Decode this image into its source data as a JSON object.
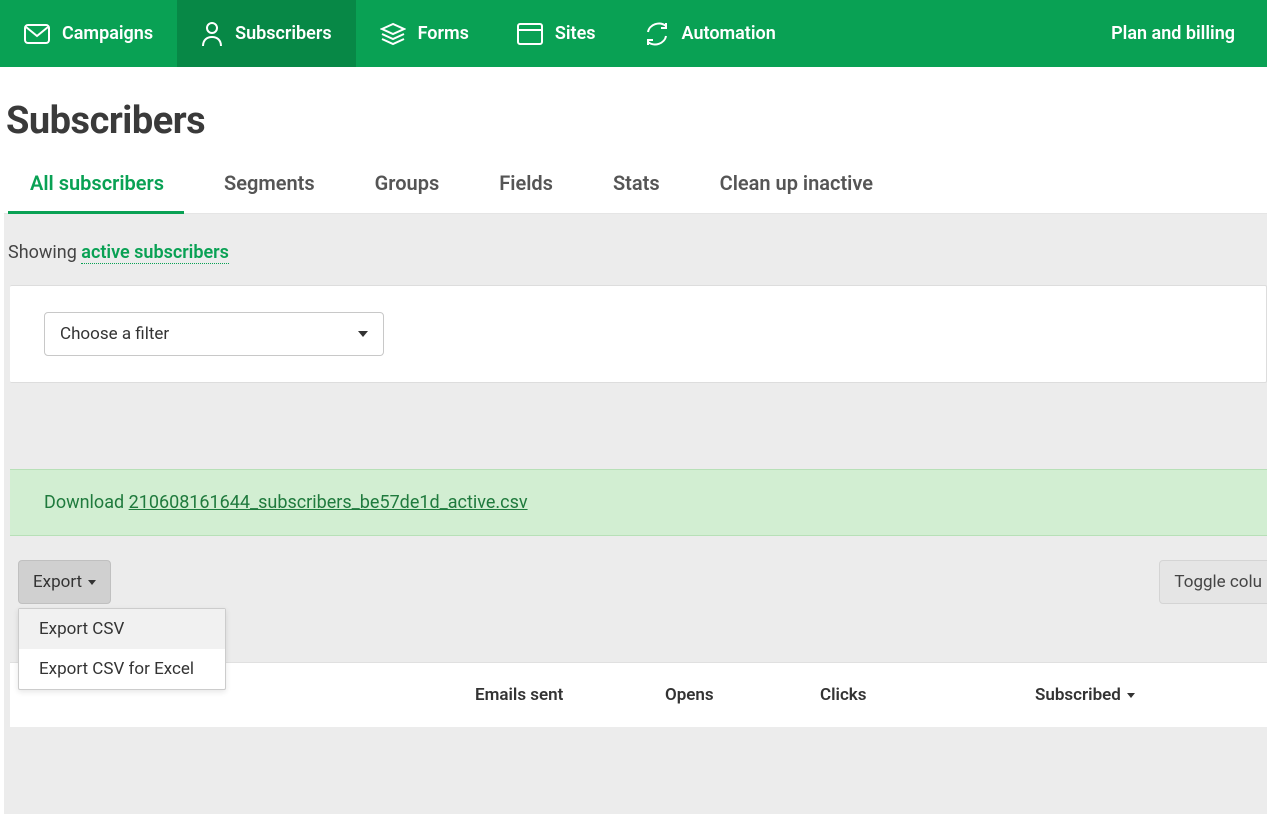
{
  "colors": {
    "brand": "#09a154",
    "brand_dark": "#078846",
    "panel_bg": "#ececec",
    "success_bg": "#d2eed2"
  },
  "topnav": {
    "items": [
      {
        "label": "Campaigns",
        "icon": "mail-icon"
      },
      {
        "label": "Subscribers",
        "icon": "user-icon"
      },
      {
        "label": "Forms",
        "icon": "stack-icon"
      },
      {
        "label": "Sites",
        "icon": "window-icon"
      },
      {
        "label": "Automation",
        "icon": "refresh-icon"
      }
    ],
    "right_label": "Plan and billing"
  },
  "page": {
    "title": "Subscribers"
  },
  "subnav": {
    "items": [
      {
        "label": "All subscribers",
        "active": true
      },
      {
        "label": "Segments"
      },
      {
        "label": "Groups"
      },
      {
        "label": "Fields"
      },
      {
        "label": "Stats"
      },
      {
        "label": "Clean up inactive"
      }
    ]
  },
  "showing": {
    "prefix": "Showing ",
    "link": "active subscribers"
  },
  "filter": {
    "placeholder": "Choose a filter"
  },
  "download": {
    "prefix": "Download ",
    "filename": "210608161644_subscribers_be57de1d_active.csv"
  },
  "toolbar": {
    "export_label": "Export",
    "toggle_label": "Toggle colu",
    "export_menu": [
      {
        "label": "Export CSV"
      },
      {
        "label": "Export CSV for Excel"
      }
    ]
  },
  "table": {
    "columns": [
      {
        "label": "Emails sent"
      },
      {
        "label": "Opens"
      },
      {
        "label": "Clicks"
      },
      {
        "label": "Subscribed",
        "sortable": true
      }
    ]
  }
}
